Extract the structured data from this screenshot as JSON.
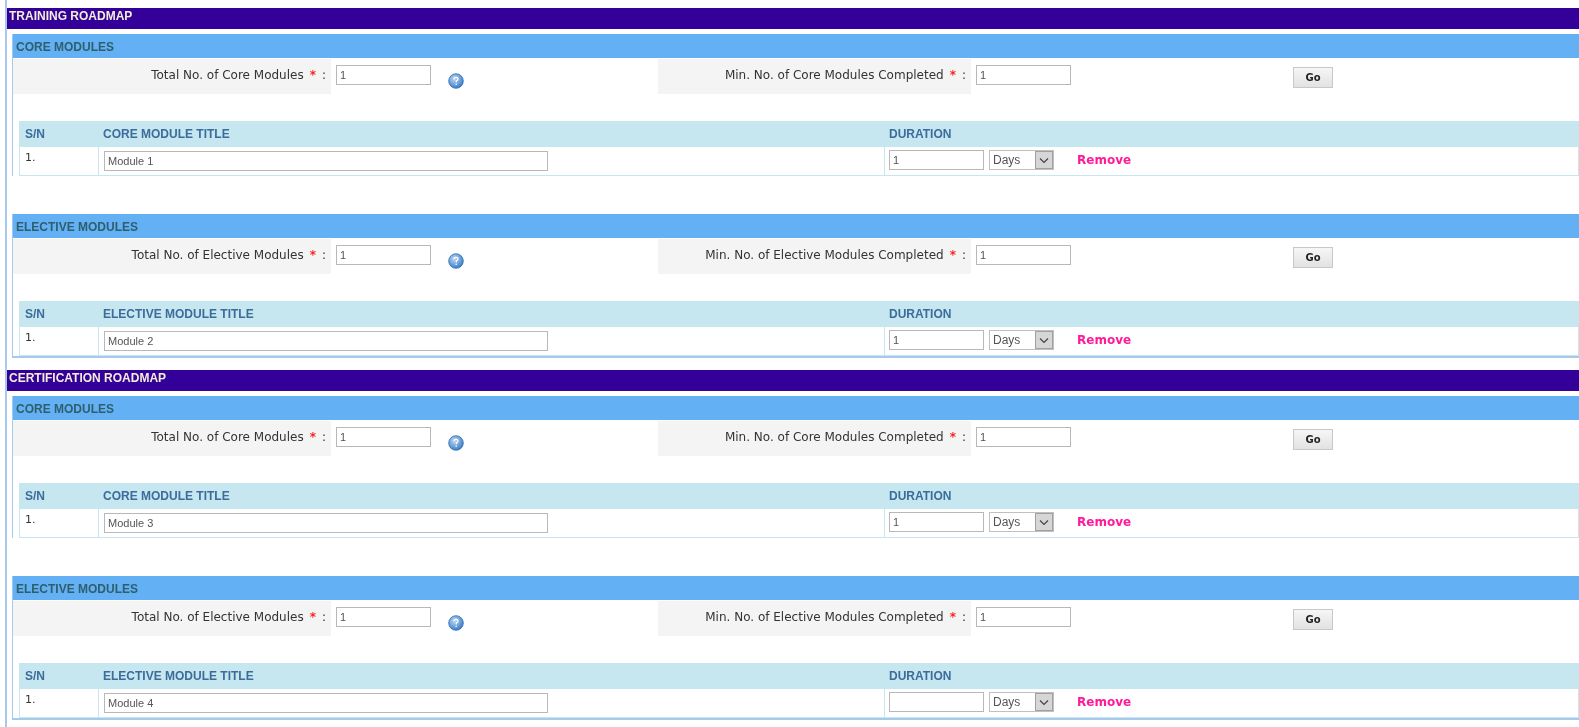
{
  "roadmaps": [
    {
      "title": "TRAINING ROADMAP",
      "sections": [
        {
          "title": "CORE MODULES",
          "total": {
            "label": "Total No. of Core Modules",
            "mark": "*",
            "suffix": ":",
            "value": "1"
          },
          "min": {
            "label": "Min. No. of Core Modules Completed",
            "mark": "*",
            "suffix": ":",
            "value": "1"
          },
          "go": "Go",
          "columns": [
            "S/N",
            "CORE MODULE TITLE",
            "DURATION"
          ],
          "rows": [
            {
              "sn": "1.",
              "title": "Module 1",
              "duration": "1",
              "unit": "Days",
              "action": "Remove"
            }
          ]
        },
        {
          "title": "ELECTIVE MODULES",
          "total": {
            "label": "Total No. of Elective Modules",
            "mark": "*",
            "suffix": ":",
            "value": "1"
          },
          "min": {
            "label": "Min. No. of Elective Modules Completed",
            "mark": "*",
            "suffix": ":",
            "value": "1"
          },
          "go": "Go",
          "columns": [
            "S/N",
            "ELECTIVE MODULE TITLE",
            "DURATION"
          ],
          "rows": [
            {
              "sn": "1.",
              "title": "Module 2",
              "duration": "1",
              "unit": "Days",
              "action": "Remove"
            }
          ]
        }
      ]
    },
    {
      "title": "CERTIFICATION ROADMAP",
      "sections": [
        {
          "title": "CORE MODULES",
          "total": {
            "label": "Total No. of Core Modules",
            "mark": "*",
            "suffix": ":",
            "value": "1"
          },
          "min": {
            "label": "Min. No. of Core Modules Completed",
            "mark": "*",
            "suffix": ":",
            "value": "1"
          },
          "go": "Go",
          "columns": [
            "S/N",
            "CORE MODULE TITLE",
            "DURATION"
          ],
          "rows": [
            {
              "sn": "1.",
              "title": "Module 3",
              "duration": "1",
              "unit": "Days",
              "action": "Remove"
            }
          ]
        },
        {
          "title": "ELECTIVE MODULES",
          "total": {
            "label": "Total No. of Elective Modules",
            "mark": "*",
            "suffix": ":",
            "value": "1"
          },
          "min": {
            "label": "Min. No. of Elective Modules Completed",
            "mark": "*",
            "suffix": ":",
            "value": "1"
          },
          "go": "Go",
          "columns": [
            "S/N",
            "ELECTIVE MODULE TITLE",
            "DURATION"
          ],
          "rows": [
            {
              "sn": "1.",
              "title": "Module 4",
              "unit": "Days",
              "action": "Remove"
            }
          ]
        }
      ]
    }
  ]
}
